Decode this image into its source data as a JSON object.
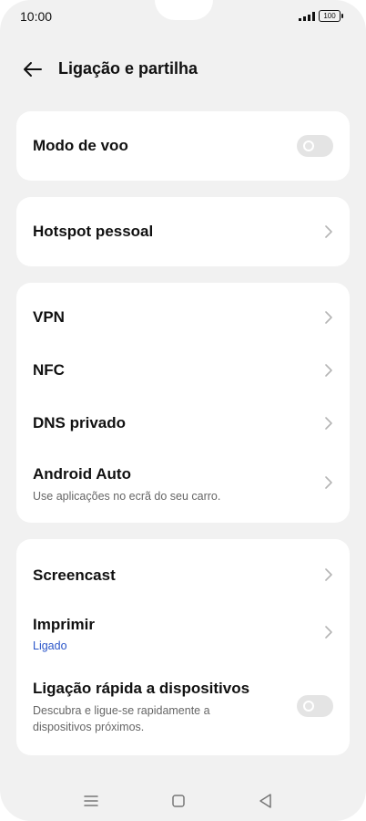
{
  "status": {
    "time": "10:00",
    "battery": "100"
  },
  "header": {
    "title": "Ligação e partilha"
  },
  "groups": [
    {
      "items": [
        {
          "title": "Modo de voo",
          "control": "toggle",
          "state": false
        }
      ]
    },
    {
      "items": [
        {
          "title": "Hotspot pessoal",
          "control": "chevron"
        }
      ]
    },
    {
      "items": [
        {
          "title": "VPN",
          "control": "chevron"
        },
        {
          "title": "NFC",
          "control": "chevron"
        },
        {
          "title": "DNS privado",
          "control": "chevron"
        },
        {
          "title": "Android Auto",
          "subtitle": "Use aplicações no ecrã do seu carro.",
          "control": "chevron"
        }
      ]
    },
    {
      "items": [
        {
          "title": "Screencast",
          "control": "chevron"
        },
        {
          "title": "Imprimir",
          "subtitle": "Ligado",
          "control": "chevron"
        },
        {
          "title": "Ligação rápida a dispositivos",
          "subtitle": "Descubra e ligue-se rapidamente a dispositivos próximos.",
          "control": "toggle",
          "state": false
        }
      ]
    }
  ],
  "colors": {
    "accent": "#2a55c9",
    "background": "#f1f1f1",
    "card": "#ffffff",
    "toggle_off": "#e4e4e4"
  },
  "navbar": {
    "icons": [
      "menu-icon",
      "home-icon",
      "back-icon"
    ]
  }
}
